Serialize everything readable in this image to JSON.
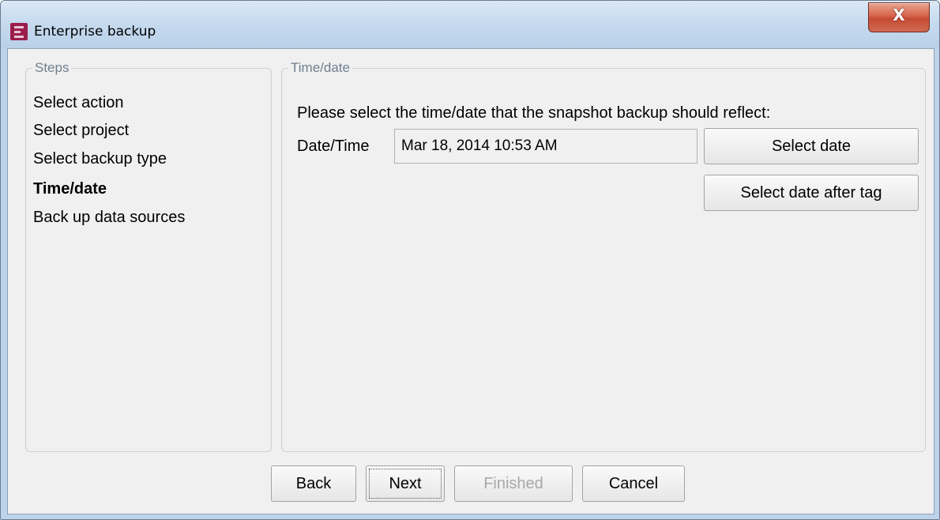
{
  "window": {
    "title": "Enterprise backup",
    "close_glyph": "X"
  },
  "steps": {
    "label": "Steps",
    "items": [
      {
        "label": "Select action",
        "active": false
      },
      {
        "label": "Select project",
        "active": false
      },
      {
        "label": "Select backup type",
        "active": false
      },
      {
        "label": "Time/date",
        "active": true
      },
      {
        "label": "Back up data sources",
        "active": false
      }
    ]
  },
  "timedate": {
    "label": "Time/date",
    "instruction": "Please select the time/date that the snapshot backup should reflect:",
    "datetime_label": "Date/Time",
    "datetime_value": "Mar 18, 2014 10:53 AM",
    "select_date_label": "Select date",
    "select_after_tag_label": "Select date after tag"
  },
  "footer": {
    "back_label": "Back",
    "next_label": "Next",
    "finished_label": "Finished",
    "finished_enabled": false,
    "cancel_label": "Cancel"
  },
  "icons": {
    "app": "enterprise-backup-icon",
    "close": "close-icon"
  },
  "colors": {
    "app_icon": "#9b1d4a",
    "close_button": "#c54a33",
    "group_label": "#6f8090",
    "disabled_text": "#a8a8a8"
  }
}
